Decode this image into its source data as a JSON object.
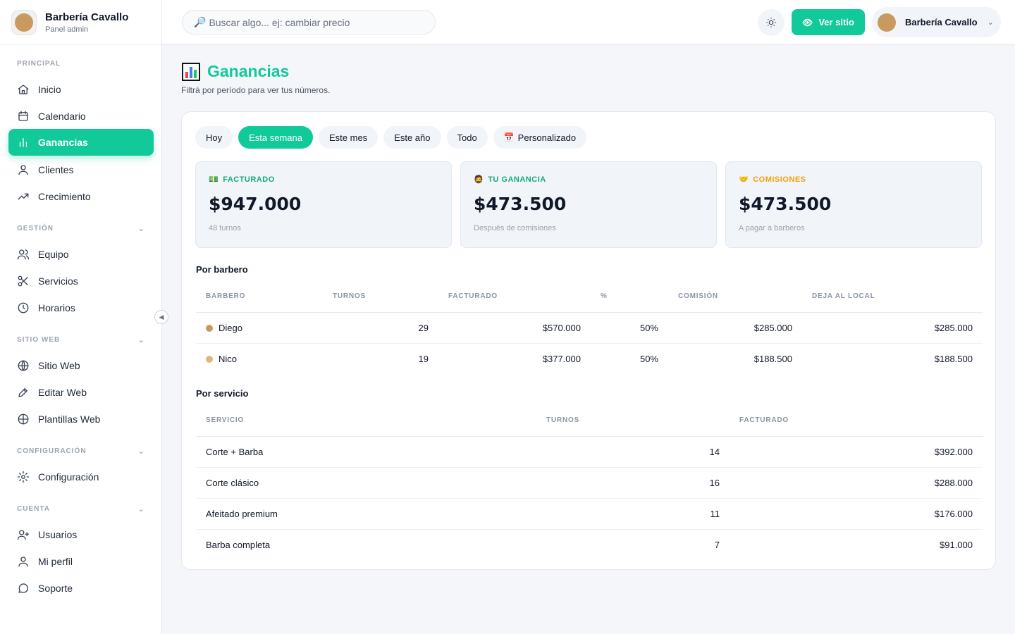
{
  "brand": {
    "name": "Barbería Cavallo",
    "subtitle": "Panel admin"
  },
  "sidebar": {
    "sections": [
      {
        "title": "PRINCIPAL",
        "items": [
          "Inicio",
          "Calendario",
          "Ganancias",
          "Clientes",
          "Crecimiento"
        ]
      },
      {
        "title": "GESTIÓN",
        "items": [
          "Equipo",
          "Servicios",
          "Horarios"
        ]
      },
      {
        "title": "SITIO WEB",
        "items": [
          "Sitio Web",
          "Editar Web",
          "Plantillas Web"
        ]
      },
      {
        "title": "CONFIGURACIÓN",
        "items": [
          "Configuración"
        ]
      },
      {
        "title": "CUENTA",
        "items": [
          "Usuarios",
          "Mi perfil",
          "Soporte"
        ]
      }
    ],
    "active_item": "Ganancias"
  },
  "topbar": {
    "search_placeholder": "Buscar algo... ej: cambiar precio",
    "visit_label": "Ver sitio",
    "user_name": "Barbería Cavallo"
  },
  "page": {
    "title": "Ganancias",
    "subtitle": "Filtrá por período para ver tus números."
  },
  "filters": {
    "options": [
      "Hoy",
      "Esta semana",
      "Este mes",
      "Este año",
      "Todo",
      "Personalizado"
    ],
    "active": "Esta semana"
  },
  "stats": [
    {
      "label": "FACTURADO",
      "icon": "💵",
      "value": "$947.000",
      "note": "48 turnos",
      "color": "#12a87f"
    },
    {
      "label": "TU GANANCIA",
      "icon": "🧔",
      "value": "$473.500",
      "note": "Después de comisiones",
      "color": "#12a87f"
    },
    {
      "label": "COMISIONES",
      "icon": "🤝",
      "value": "$473.500",
      "note": "A pagar a barberos",
      "color": "#f59e0b"
    }
  ],
  "by_barber": {
    "title": "Por barbero",
    "headers": [
      "BARBERO",
      "TURNOS",
      "FACTURADO",
      "%",
      "COMISIÓN",
      "DEJA AL LOCAL"
    ],
    "rows": [
      {
        "name": "Diego",
        "color": "#c99a5f",
        "turnos": "29",
        "facturado": "$570.000",
        "pct": "50%",
        "comision": "$285.000",
        "local": "$285.000"
      },
      {
        "name": "Nico",
        "color": "#dfb87d",
        "turnos": "19",
        "facturado": "$377.000",
        "pct": "50%",
        "comision": "$188.500",
        "local": "$188.500"
      }
    ]
  },
  "by_service": {
    "title": "Por servicio",
    "headers": [
      "SERVICIO",
      "TURNOS",
      "FACTURADO"
    ],
    "rows": [
      {
        "name": "Corte + Barba",
        "turnos": "14",
        "facturado": "$392.000"
      },
      {
        "name": "Corte clásico",
        "turnos": "16",
        "facturado": "$288.000"
      },
      {
        "name": "Afeitado premium",
        "turnos": "11",
        "facturado": "$176.000"
      },
      {
        "name": "Barba completa",
        "turnos": "7",
        "facturado": "$91.000"
      }
    ]
  }
}
